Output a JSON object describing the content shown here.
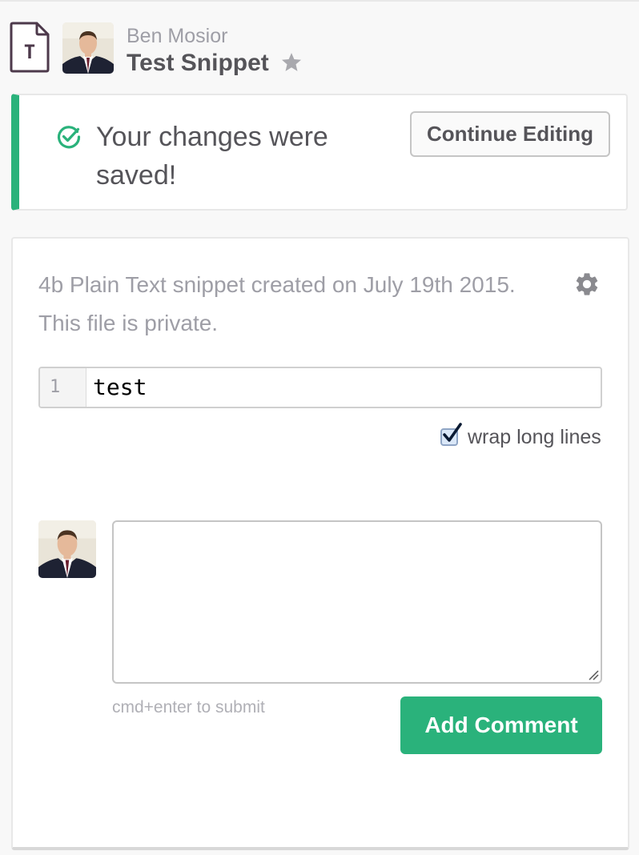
{
  "header": {
    "file_type_icon": "plain-text-file-icon",
    "file_type_letter": "T",
    "author": "Ben Mosior",
    "title": "Test Snippet",
    "star_icon": "star-icon"
  },
  "alert": {
    "icon": "check-circle-icon",
    "message": "Your changes were saved!",
    "continue_label": "Continue Editing",
    "accent_color": "#2ab27b"
  },
  "file": {
    "meta": "4b Plain Text snippet created on July 19th 2015. This file is private.",
    "settings_icon": "gear-icon",
    "line_number": "1",
    "code": "test",
    "wrap_label": "wrap long lines",
    "wrap_checked": true
  },
  "comment": {
    "hint": "cmd+enter to submit",
    "submit_label": "Add Comment",
    "submit_color": "#2ab27b"
  }
}
